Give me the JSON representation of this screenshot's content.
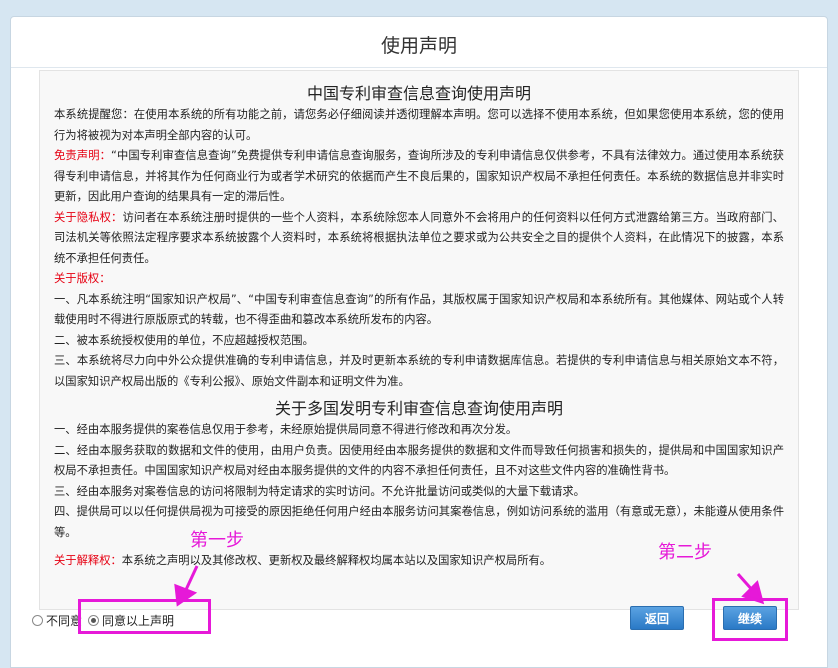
{
  "dialog": {
    "title": "使用声明"
  },
  "declaration": {
    "heading1": "中国专利审查信息查询使用声明",
    "intro": "本系统提醒您：在使用本系统的所有功能之前，请您务必仔细阅读并透彻理解本声明。您可以选择不使用本系统，但如果您使用本系统，您的使用行为将被视为对本声明全部内容的认可。",
    "disclaimer_label": "免责声明：",
    "disclaimer_text": "“中国专利审查信息查询”免费提供专利申请信息查询服务，查询所涉及的专利申请信息仅供参考，不具有法律效力。通过使用本系统获得专利申请信息，并将其作为任何商业行为或者学术研究的依据而产生不良后果的，国家知识产权局不承担任何责任。本系统的数据信息并非实时更新，因此用户查询的结果具有一定的滞后性。",
    "privacy_label": "关于隐私权：",
    "privacy_text": "访问者在本系统注册时提供的一些个人资料，本系统除您本人同意外不会将用户的任何资料以任何方式泄露给第三方。当政府部门、司法机关等依照法定程序要求本系统披露个人资料时，本系统将根据执法单位之要求或为公共安全之目的提供个人资料，在此情况下的披露，本系统不承担任何责任。",
    "copyright_label": "关于版权：",
    "copyright_items": [
      "一、凡本系统注明“国家知识产权局”、“中国专利审查信息查询”的所有作品，其版权属于国家知识产权局和本系统所有。其他媒体、网站或个人转载使用时不得进行原版原式的转载，也不得歪曲和篡改本系统所发布的内容。",
      "二、被本系统授权使用的单位，不应超越授权范围。",
      "三、本系统将尽力向中外公众提供准确的专利申请信息，并及时更新本系统的专利申请数据库信息。若提供的专利申请信息与相关原始文本不符，以国家知识产权局出版的《专利公报》、原始文件副本和证明文件为准。"
    ],
    "heading2": "关于多国发明专利审查信息查询使用声明",
    "multi_items": [
      "一、经由本服务提供的案卷信息仅用于参考，未经原始提供局同意不得进行修改和再次分发。",
      "二、经由本服务获取的数据和文件的使用，由用户负责。因使用经由本服务提供的数据和文件而导致任何损害和损失的，提供局和中国国家知识产权局不承担责任。中国国家知识产权局对经由本服务提供的文件的内容不承担任何责任，且不对这些文件内容的准确性背书。",
      "三、经由本服务对案卷信息的访问将限制为特定请求的实时访问。不允许批量访问或类似的大量下载请求。",
      "四、提供局可以以任何提供局视为可接受的原因拒绝任何用户经由本服务访问其案卷信息，例如访问系统的滥用（有意或无意），未能遵从使用条件等。"
    ],
    "interpretation_label": "关于解释权：",
    "interpretation_text": "本系统之声明以及其修改权、更新权及最终解释权均属本站以及国家知识产权局所有。"
  },
  "footer": {
    "disagree_label": "不同意",
    "agree_label": "同意以上声明",
    "selected": "agree",
    "back_label": "返回",
    "continue_label": "继续"
  },
  "annotations": {
    "step1": "第一步",
    "step2": "第二步",
    "color": "#e619d8"
  }
}
